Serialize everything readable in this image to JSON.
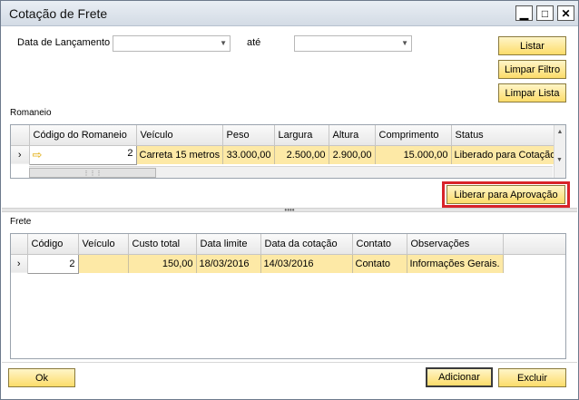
{
  "window": {
    "title": "Cotação de Frete",
    "controls": {
      "minimize": "▁",
      "maximize": "□",
      "close": "✕"
    }
  },
  "filters": {
    "date_from_label": "Data de Lançamento",
    "date_from_value": "",
    "date_to_label": "até",
    "date_to_value": ""
  },
  "buttons": {
    "listar": "Listar",
    "limpar_filtro": "Limpar Filtro",
    "limpar_lista": "Limpar Lista",
    "liberar": "Liberar para Aprovação",
    "ok": "Ok",
    "adicionar": "Adicionar",
    "excluir": "Excluir"
  },
  "romaneio": {
    "label": "Romaneio",
    "columns": [
      "Código do Romaneio",
      "Veículo",
      "Peso",
      "Largura",
      "Altura",
      "Comprimento",
      "Status"
    ],
    "row": {
      "codigo": "2",
      "veiculo": "Carreta 15 metros",
      "peso": "33.000,00",
      "largura": "2.500,00",
      "altura": "2.900,00",
      "comprimento": "15.000,00",
      "status": "Liberado para Cotação"
    },
    "row_indicator": "›"
  },
  "frete": {
    "label": "Frete",
    "columns": [
      "Código",
      "Veículo",
      "Custo total",
      "Data limite",
      "Data da cotação",
      "Contato",
      "Observações"
    ],
    "row": {
      "codigo": "2",
      "veiculo": "",
      "custo_total": "150,00",
      "data_limite": "18/03/2016",
      "data_cotacao": "14/03/2016",
      "contato": "Contato",
      "observacoes": "Informações Gerais."
    },
    "row_indicator": "›"
  },
  "icons": {
    "link_arrow": "⇨",
    "combo_arrow": "▼",
    "scroll_up": "▲",
    "scroll_down": "▼",
    "grip": "⋮⋮⋮",
    "splitter_grip": "••••"
  }
}
